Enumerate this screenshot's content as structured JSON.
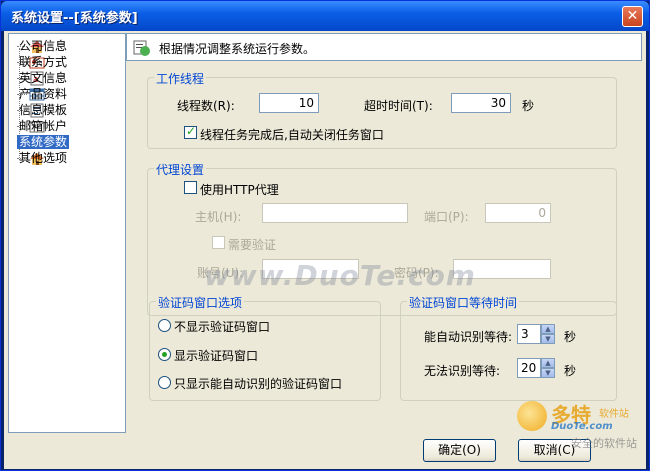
{
  "window": {
    "title": "系统设置--[系统参数]",
    "close_glyph": "✕"
  },
  "tree": {
    "items": [
      {
        "label": "公司信息",
        "icon": "house-icon"
      },
      {
        "label": "联系方式",
        "icon": "contact-card-icon"
      },
      {
        "label": "英文信息",
        "icon": "english-doc-icon"
      },
      {
        "label": "产品资料",
        "icon": "product-table-icon"
      },
      {
        "label": "信息模板",
        "icon": "template-icon"
      },
      {
        "label": "邮箱帐户",
        "icon": "mailbox-icon"
      },
      {
        "label": "系统参数",
        "icon": "system-params-icon",
        "selected": true
      },
      {
        "label": "其他选项",
        "icon": "house-icon"
      }
    ]
  },
  "info": {
    "text": "根据情况调整系统运行参数。"
  },
  "work_thread": {
    "legend": "工作线程",
    "threads_label": "线程数(R):",
    "threads_value": "10",
    "timeout_label": "超时时间(T):",
    "timeout_value": "30",
    "timeout_unit": "秒",
    "autoclose_label": "线程任务完成后,自动关闭任务窗口",
    "autoclose_checked": true
  },
  "proxy": {
    "legend": "代理设置",
    "use_http_label": "使用HTTP代理",
    "use_http_checked": false,
    "host_label": "主机(H):",
    "host_value": "",
    "port_label": "端口(P):",
    "port_value": "0",
    "need_auth_label": "需要验证",
    "account_label": "账号(U):",
    "account_value": "",
    "password_label": "密码(P):",
    "password_value": ""
  },
  "captcha_options": {
    "legend": "验证码窗口选项",
    "options": [
      {
        "label": "不显示验证码窗口",
        "selected": false
      },
      {
        "label": "显示验证码窗口",
        "selected": true
      },
      {
        "label": "只显示能自动识别的验证码窗口",
        "selected": false
      }
    ]
  },
  "captcha_wait": {
    "legend": "验证码窗口等待时间",
    "auto_label": "能自动识别等待:",
    "auto_value": "3",
    "manual_label": "无法识别等待:",
    "manual_value": "20",
    "unit": "秒"
  },
  "buttons": {
    "ok": "确定(O)",
    "cancel": "取消(C)"
  },
  "watermark": {
    "site": "www.DuoTe.com",
    "logo_main": "多特",
    "logo_sub": "软件站",
    "logo_url": "DuoTe.com",
    "logo_tag": "安全的软件站"
  }
}
